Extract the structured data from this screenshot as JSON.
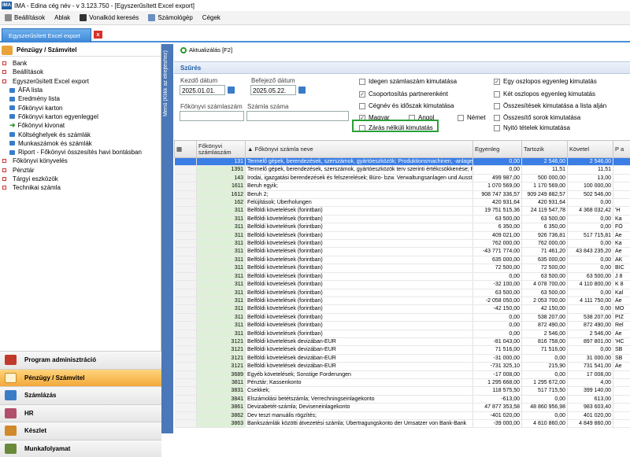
{
  "window_title": "IMA - Edina cég név - v 3.123.750 - [Egyszerűsített Excel export]",
  "menu": [
    "Beállítások",
    "Ablak",
    "Vonalkód keresés",
    "Számológép",
    "Cégek"
  ],
  "tab": {
    "label": "Egyszerűsített Excel export",
    "close": "x"
  },
  "sidebar": {
    "header": "Pénzügy / Számvitel",
    "items": [
      {
        "label": "Bank",
        "level": 0
      },
      {
        "label": "Beállítások",
        "level": 0
      },
      {
        "label": "Egyszerűsített Excel export",
        "level": 0
      },
      {
        "label": "ÁFA lista",
        "level": 1
      },
      {
        "label": "Eredmény lista",
        "level": 1
      },
      {
        "label": "Főkönyvi karton",
        "level": 1
      },
      {
        "label": "Főkönyvi karton egyenleggel",
        "level": 1
      },
      {
        "label": "Főkönyvi kivonat",
        "level": 1,
        "icon": "arrow"
      },
      {
        "label": "Költséghelyek  és számlák",
        "level": 1
      },
      {
        "label": "Munkaszámok és számlák",
        "level": 1
      },
      {
        "label": "Riport - Főkönyvi összesítés havi bontásban",
        "level": 1
      },
      {
        "label": "Főkönyvi könyvelés",
        "level": 0
      },
      {
        "label": "Pénztár",
        "level": 0
      },
      {
        "label": "Tárgyi eszközök",
        "level": 0
      },
      {
        "label": "Technikai számla",
        "level": 0
      }
    ],
    "nav": [
      {
        "label": "Program adminisztráció",
        "color": "#c0392b",
        "active": false
      },
      {
        "label": "Pénzügy / Számvitel",
        "color": "#e8a33a",
        "active": true
      },
      {
        "label": "Számlázás",
        "color": "#3a7cc8",
        "active": false
      },
      {
        "label": "HR",
        "color": "#b0506a",
        "active": false
      },
      {
        "label": "Készlet",
        "color": "#d08a2a",
        "active": false
      },
      {
        "label": "Munkafolyamat",
        "color": "#6a8a3a",
        "active": false
      }
    ]
  },
  "vertical_strip": "Menü (Klikk az elrejtéshez)",
  "refresh_label": "Aktualizálás [F2]",
  "filter": {
    "title": "Szűrés",
    "start_label": "Kezdő dátum",
    "start_value": "2025.01.01.",
    "end_label": "Befejező dátum",
    "end_value": "2025.05.22.",
    "account_label": "Főkönyvi számlaszám",
    "account_value": "",
    "invoice_label": "Számla száma",
    "invoice_value": "",
    "checks": {
      "idegen": {
        "label": "Idegen számlaszám kimutatása",
        "checked": false
      },
      "csoport": {
        "label": "Csoportosítás partnerenként",
        "checked": true
      },
      "cegnev": {
        "label": "Cégnév és időszak kimutatása",
        "checked": false
      },
      "magyar": {
        "label": "Magyar",
        "checked": true
      },
      "angol": {
        "label": "Angol",
        "checked": false
      },
      "nemet": {
        "label": "Német",
        "checked": false
      },
      "zaras": {
        "label": "Zárás nélküli kimutatás",
        "checked": false
      },
      "egyoszlop": {
        "label": "Egy oszlopos egyenleg kimutatás",
        "checked": true
      },
      "ketoszlop": {
        "label": "Két oszlopos egyenleg kimutatás",
        "checked": false
      },
      "osszesites": {
        "label": "Összesítések kimutatása a lista alján",
        "checked": false
      },
      "osszesito": {
        "label": "Összesítő sorok kimutatása",
        "checked": false
      },
      "nyito": {
        "label": "Nyitó tételek kimutatása",
        "checked": false
      }
    }
  },
  "table": {
    "headers": [
      "Főkönyvi számlaszám",
      "Főkönyvi számla neve",
      "Egyenleg",
      "Tartozik",
      "Követel",
      "P a"
    ],
    "rows": [
      [
        "131",
        "Termelő gépek, berendezések, szerszámok, gyártóeszközök; Produktionsmachinen, -anlage",
        "0,00",
        "2 546,00",
        "2 546,00",
        ""
      ],
      [
        "1391",
        "Termelő gépek, berendezések, szerszámok, gyártóeszközök terv szerinti értékcsökkenése; Pl",
        "0,00",
        "11,51",
        "11,51",
        ""
      ],
      [
        "143",
        "Irodai, igazgatási berendezések és felszerelések; Büro- bzw. Verwaltungsanlagen und Ausst",
        "499 987,00",
        "500 000,00",
        "13,00",
        ""
      ],
      [
        "1611",
        "Beruh egyik;",
        "1 070 569,00",
        "1 170 569,00",
        "100 000,00",
        ""
      ],
      [
        "1612",
        "Beruh 2;",
        "908 747 336,57",
        "909 249 882,57",
        "502 546,00",
        ""
      ],
      [
        "162",
        "Felújítások; Überholungen",
        "420 931,64",
        "420 931,64",
        "0,00",
        ""
      ],
      [
        "311",
        "Belföldi követelések (forintban)",
        "19 751 515,36",
        "24 119 547,78",
        "4 368 032,42",
        "'H"
      ],
      [
        "311",
        "Belföldi követelések (forintban)",
        "63 500,00",
        "63 500,00",
        "0,00",
        "Ka"
      ],
      [
        "311",
        "Belföldi követelések (forintban)",
        "6 350,00",
        "6 350,00",
        "0,00",
        "FŐ"
      ],
      [
        "311",
        "Belföldi követelések (forintban)",
        "409 021,00",
        "926 736,81",
        "517 715,81",
        "Ae"
      ],
      [
        "311",
        "Belföldi követelések (forintban)",
        "762 000,00",
        "762 000,00",
        "0,00",
        "Ka"
      ],
      [
        "311",
        "Belföldi követelések (forintban)",
        "-43 771 774,00",
        "71 461,20",
        "43 843 235,20",
        "Ae"
      ],
      [
        "311",
        "Belföldi követelések (forintban)",
        "635 000,00",
        "635 000,00",
        "0,00",
        "AK"
      ],
      [
        "311",
        "Belföldi követelések (forintban)",
        "72 500,00",
        "72 500,00",
        "0,00",
        "BIC"
      ],
      [
        "311",
        "Belföldi követelések (forintban)",
        "0,00",
        "63 500,00",
        "63 500,00",
        "J 8"
      ],
      [
        "311",
        "Belföldi követelések (forintban)",
        "-32 100,00",
        "4 078 700,00",
        "4 110 800,00",
        "K 8"
      ],
      [
        "311",
        "Belföldi követelések (forintban)",
        "63 500,00",
        "63 500,00",
        "0,00",
        "Kal"
      ],
      [
        "311",
        "Belföldi követelések (forintban)",
        "-2 058 050,00",
        "2 053 700,00",
        "4 111 750,00",
        "Ae"
      ],
      [
        "311",
        "Belföldi követelések (forintban)",
        "-42 150,00",
        "42 150,00",
        "0,00",
        "MO"
      ],
      [
        "311",
        "Belföldi követelések (forintban)",
        "0,00",
        "538 207,00",
        "538 207,00",
        "PIZ"
      ],
      [
        "311",
        "Belföldi követelések (forintban)",
        "0,00",
        "872 490,00",
        "872 490,00",
        "Rel"
      ],
      [
        "311",
        "Belföldi követelések (forintban)",
        "0,00",
        "2 546,00",
        "2 546,00",
        "Ae"
      ],
      [
        "3121",
        "Belföldi követelések devizában-EUR",
        "-81 043,00",
        "816 758,00",
        "897 801,00",
        "'HC"
      ],
      [
        "3121",
        "Belföldi követelések devizában-EUR",
        "71 516,00",
        "71 516,00",
        "0,00",
        "SB"
      ],
      [
        "3121",
        "Belföldi követelések devizában-EUR",
        "-31 000,00",
        "0,00",
        "31 000,00",
        "SB"
      ],
      [
        "3121",
        "Belföldi követelések devizában-EUR",
        "-731 325,10",
        "215,90",
        "731 541,00",
        "Ae"
      ],
      [
        "3689",
        "Egyéb követelések; Sonstige Forderungen",
        "-17 008,00",
        "0,00",
        "17 008,00",
        ""
      ],
      [
        "3811",
        "Pénztár; Kassenkonto",
        "1 295 668,00",
        "1 295 672,00",
        "4,00",
        ""
      ],
      [
        "3831",
        "Csekkek;",
        "118 575,50",
        "517 715,50",
        "399 140,00",
        ""
      ],
      [
        "3841",
        "Elszámolási betétszámla; Verrechningseinlagekonto",
        "-613,00",
        "0,00",
        "613,00",
        ""
      ],
      [
        "3861",
        "Devizabetét-számla; Devisen­einlagekonto",
        "47 877 353,58",
        "48 860 956,98",
        "983 603,40",
        ""
      ],
      [
        "3862",
        "Dev teszt manuális rögzítés;",
        "-401 020,00",
        "0,00",
        "401 020,00",
        ""
      ],
      [
        "3863",
        "Bankszámlák közötti átvezetési számla; Übertragungskonto der Umsatzer von Bank-Bank",
        "-39 000,00",
        "4 810 860,00",
        "4 849 860,00",
        ""
      ]
    ]
  }
}
